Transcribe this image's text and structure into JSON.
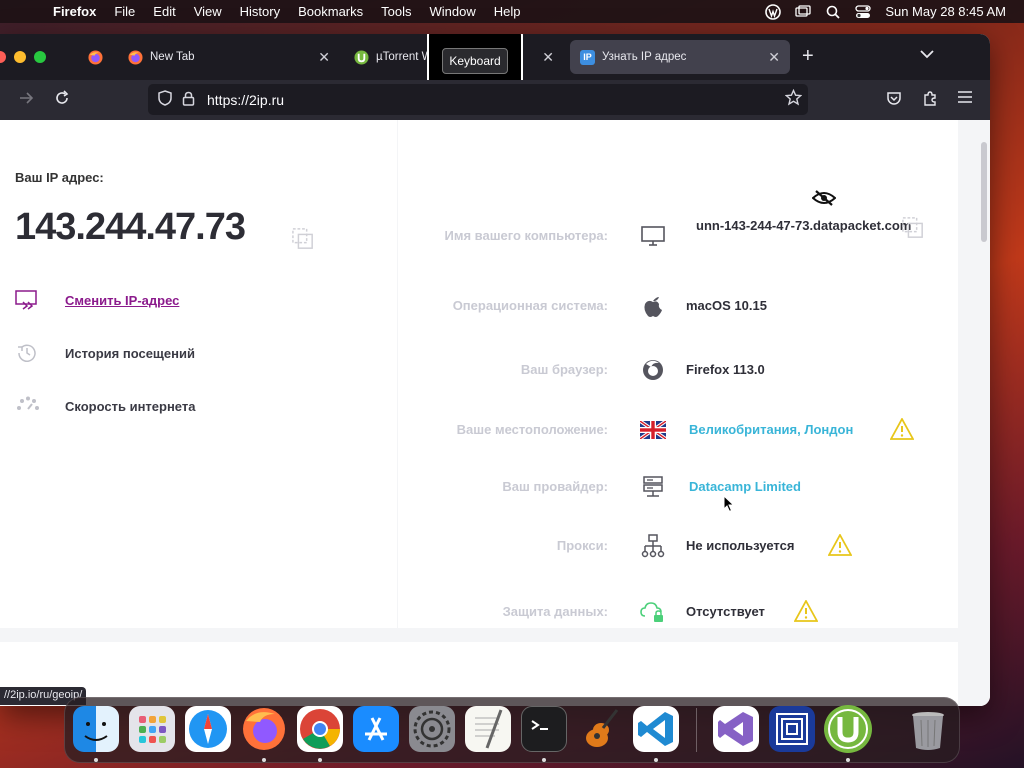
{
  "menubar": {
    "app": "Firefox",
    "items": [
      "File",
      "Edit",
      "View",
      "History",
      "Bookmarks",
      "Tools",
      "Window",
      "Help"
    ],
    "datetime": "Sun May 28  8:45 AM"
  },
  "tabs": [
    {
      "title": "New Tab",
      "icon": "firefox-icon"
    },
    {
      "title": "µTorrent W",
      "icon": "utorrent-icon"
    },
    {
      "title": "Узнать IP адрес",
      "icon": "2ip-icon"
    }
  ],
  "tooltip": "Keyboard",
  "favicon_2ip": "IP",
  "url": "https://2ip.ru",
  "left": {
    "ip_label": "Ваш IP адрес:",
    "ip_value": "143.244.47.73",
    "links": [
      {
        "label": "Сменить IP-адрес",
        "icon": "change-ip-icon"
      },
      {
        "label": "История посещений",
        "icon": "history-icon"
      },
      {
        "label": "Скорость интернета",
        "icon": "speed-icon"
      }
    ]
  },
  "right": {
    "rows": [
      {
        "label": "Имя вашего компьютера:",
        "value": "unn-143-244-47-73.datapacket.com",
        "icon": "computer-icon"
      },
      {
        "label": "Операционная система:",
        "value": "macOS 10.15",
        "icon": "apple-icon"
      },
      {
        "label": "Ваш браузер:",
        "value": "Firefox 113.0",
        "icon": "firefox-icon"
      },
      {
        "label": "Ваше местоположение:",
        "value": "Великобритания, Лондон",
        "icon": "uk-flag-icon",
        "warning": true
      },
      {
        "label": "Ваш провайдер:",
        "value": "Datacamp Limited",
        "icon": "server-icon"
      },
      {
        "label": "Прокси:",
        "value": "Не используется",
        "icon": "proxy-icon",
        "warning": true
      },
      {
        "label": "Защита данных:",
        "value": "Отсутствует",
        "icon": "cloud-lock-icon",
        "warning": true
      }
    ]
  },
  "status_url": "//2ip.io/ru/geoip/",
  "dock": [
    "Finder",
    "Launchpad",
    "Safari",
    "Firefox",
    "Chrome",
    "App Store",
    "System Preferences",
    "TextEdit",
    "Terminal",
    "GarageBand",
    "VS Code",
    "Visual Studio",
    "Remote",
    "µTorrent",
    "Trash"
  ],
  "colors": {
    "accent_link": "#39b5d8",
    "primary_link": "#8b1a8c",
    "warning": "#e8c61a"
  }
}
